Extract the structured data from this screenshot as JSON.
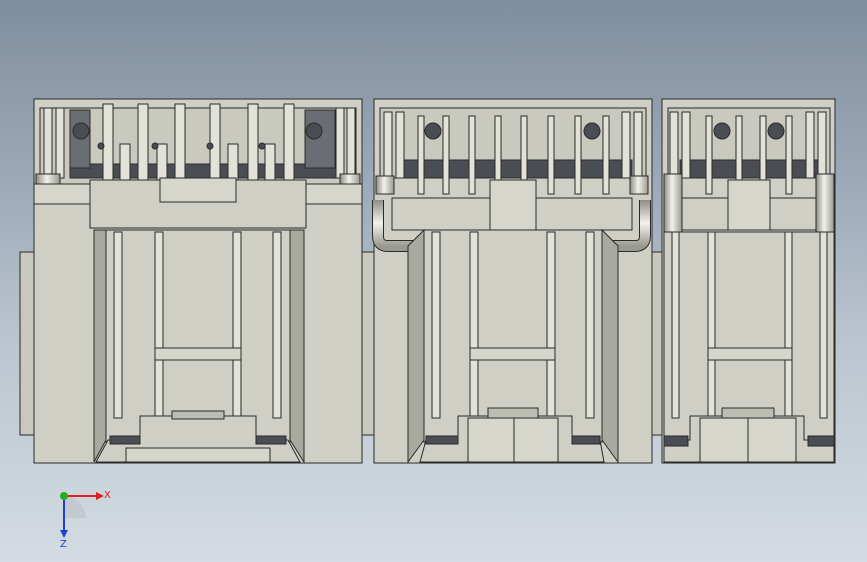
{
  "viewport": {
    "background_top": "#7f8e9e",
    "background_bottom": "#d4dbe2"
  },
  "model": {
    "body_color": "#cfcfc5",
    "shade_color": "#a9a99f",
    "dark_color": "#4a4e54",
    "pin_color": "#e2e2d8",
    "edge_color": "#2a2a2a",
    "parts": [
      "connector-left",
      "connector-middle",
      "connector-right"
    ]
  },
  "triad": {
    "x_label": "X",
    "z_label": "Z",
    "x_color": "#e02020",
    "y_color": "#20b020",
    "z_color": "#2040d0"
  }
}
